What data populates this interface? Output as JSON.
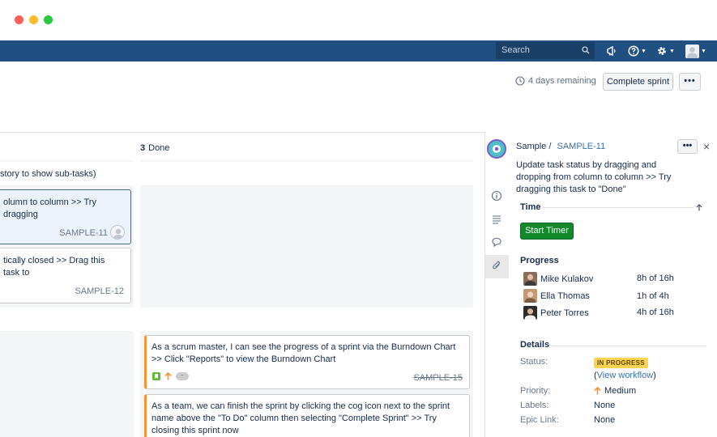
{
  "nav": {
    "search_placeholder": "Search"
  },
  "sprint": {
    "remaining": "4 days remaining",
    "complete_label": "Complete sprint",
    "more_label": "•••"
  },
  "board": {
    "done_count": "3",
    "done_label": "Done",
    "swimlane_label": "story to show sub-tasks)",
    "cards_top": [
      {
        "text": "olumn to column >> Try dragging",
        "key": "SAMPLE-11"
      },
      {
        "text": "tically closed >> Drag this task to",
        "key": "SAMPLE-12"
      }
    ],
    "cards_done": [
      {
        "text": "As a scrum master, I can see the progress of a sprint via the Burndown Chart >> Click \"Reports\" to view the Burndown Chart",
        "key": "SAMPLE-15"
      },
      {
        "text": "As a team, we can finish the sprint by clicking the cog icon next to the sprint name above the \"To Do\" column then selecting \"Complete Sprint\" >> Try closing this sprint now"
      }
    ]
  },
  "detail": {
    "project": "Sample",
    "separator": "/",
    "issue_key": "SAMPLE-11",
    "more_label": "•••",
    "close": "×",
    "summary": "Update task status by dragging and dropping from column to column >> Try dragging this task to \"Done\"",
    "time_title": "Time",
    "timer_label": "Start Timer",
    "progress_title": "Progress",
    "progress": [
      {
        "name": "Mike Kulakov",
        "value": "8h of 16h"
      },
      {
        "name": "Ella Thomas",
        "value": "1h of 4h"
      },
      {
        "name": "Peter Torres",
        "value": "4h of 16h"
      }
    ],
    "details_title": "Details",
    "status_label": "Status:",
    "status_value": "IN PROGRESS",
    "workflow_open": "(",
    "workflow_link": "View workflow",
    "workflow_close": ")",
    "priority_label": "Priority:",
    "priority_value": "Medium",
    "labels_label": "Labels:",
    "labels_value": "None",
    "epic_label": "Epic Link:",
    "epic_value": "None"
  },
  "colors": {
    "nav_bg": "#205081",
    "status_lozenge": "#ffd351",
    "timer_button": "#14892c",
    "link": "#3572b0"
  },
  "icons": [
    "search-icon",
    "megaphone-icon",
    "help-icon",
    "gear-icon",
    "user-avatar-icon",
    "clock-icon",
    "info-icon",
    "description-icon",
    "comment-icon",
    "attachment-icon",
    "story-icon",
    "priority-up-icon"
  ]
}
